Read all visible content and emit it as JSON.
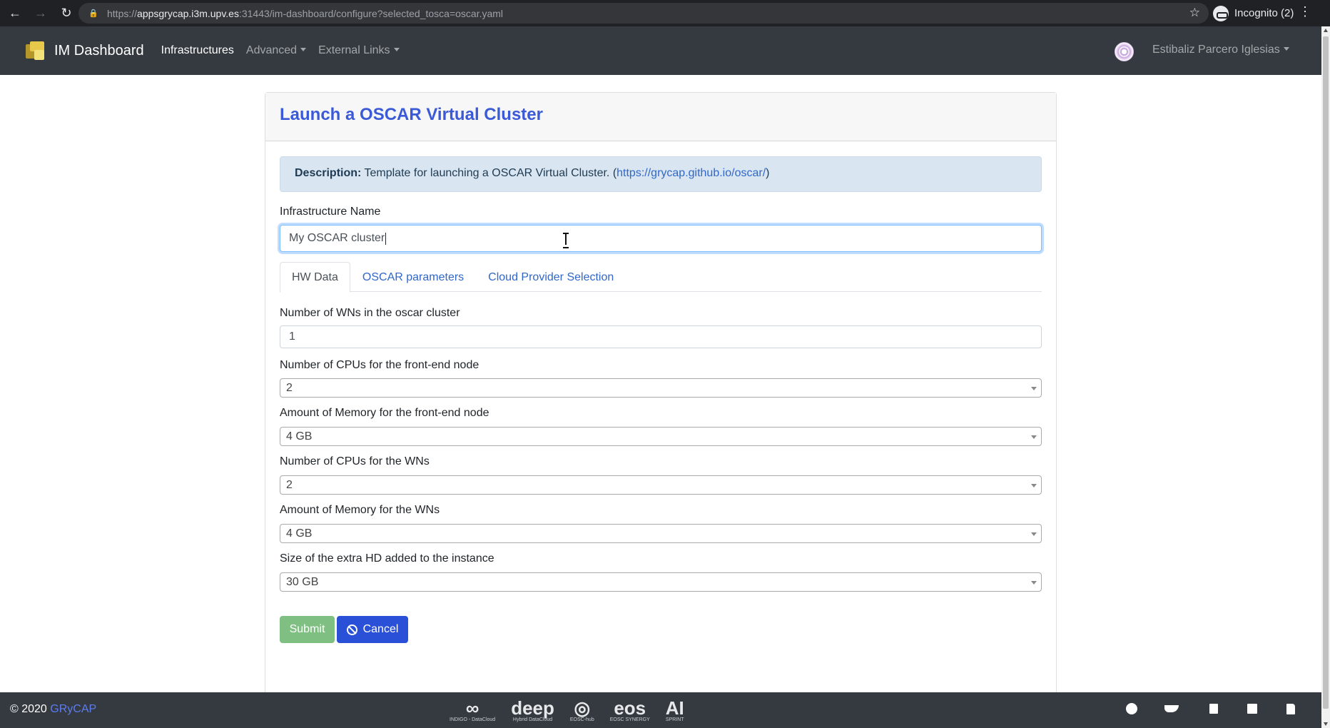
{
  "browser": {
    "url_prefix": "https://",
    "url_host": "appsgrycap.i3m.upv.es",
    "url_rest": ":31443/im-dashboard/configure?selected_tosca=oscar.yaml",
    "incognito_label": "Incognito (2)"
  },
  "navbar": {
    "brand": "IM Dashboard",
    "items": [
      {
        "label": "Infrastructures",
        "active": true,
        "dropdown": false
      },
      {
        "label": "Advanced",
        "active": false,
        "dropdown": true
      },
      {
        "label": "External Links",
        "active": false,
        "dropdown": true
      }
    ],
    "user_name": "Estibaliz Parcero Iglesias"
  },
  "card": {
    "title": "Launch a OSCAR Virtual Cluster",
    "description_label": "Description:",
    "description_text": "Template for launching a OSCAR Virtual Cluster. (",
    "description_link": "https://grycap.github.io/oscar/",
    "description_end": ")",
    "infra_name_label": "Infrastructure Name",
    "infra_name_value": "My OSCAR cluster"
  },
  "tabs": [
    {
      "label": "HW Data",
      "active": true
    },
    {
      "label": "OSCAR parameters",
      "active": false
    },
    {
      "label": "Cloud Provider Selection",
      "active": false
    }
  ],
  "fields": {
    "num_wns": {
      "label": "Number of WNs in the oscar cluster",
      "value": "1"
    },
    "fe_cpus": {
      "label": "Number of CPUs for the front-end node",
      "value": "2"
    },
    "fe_mem": {
      "label": "Amount of Memory for the front-end node",
      "value": "4 GB"
    },
    "wn_cpus": {
      "label": "Number of CPUs for the WNs",
      "value": "2"
    },
    "wn_mem": {
      "label": "Amount of Memory for the WNs",
      "value": "4 GB"
    },
    "disk_size": {
      "label": "Size of the extra HD added to the instance",
      "value": "30 GB"
    }
  },
  "buttons": {
    "submit": "Submit",
    "cancel": "Cancel"
  },
  "footer": {
    "copyright": "© 2020 ",
    "org_link": "GRyCAP",
    "partners": [
      {
        "mark": "∞",
        "sub": "INDIGO - DataCloud"
      },
      {
        "mark": "deep",
        "sub": "Hybrid DataCloud"
      },
      {
        "mark": "◎",
        "sub": "EOSC-hub"
      },
      {
        "mark": "eos",
        "sub": "EOSC SYNERGY"
      },
      {
        "mark": "AI",
        "sub": "SPRINT"
      }
    ]
  },
  "colors": {
    "navbar_bg": "#343a40",
    "title_color": "#3a5ad7",
    "alert_bg": "#d9e6f1",
    "submit_bg": "#7fbf82",
    "cancel_bg": "#2a50d8"
  }
}
